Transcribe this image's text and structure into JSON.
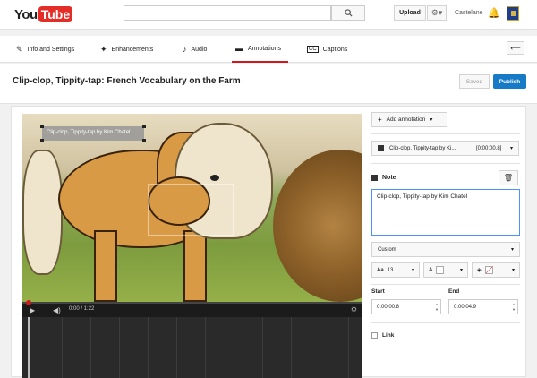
{
  "header": {
    "logo_you": "You",
    "logo_tube": "Tube",
    "search_placeholder": "",
    "upload_label": "Upload",
    "username": "Castelane"
  },
  "tabs": [
    {
      "label": "Info and Settings",
      "icon": "pencil-icon"
    },
    {
      "label": "Enhancements",
      "icon": "magic-wand-icon"
    },
    {
      "label": "Audio",
      "icon": "music-note-icon"
    },
    {
      "label": "Annotations",
      "icon": "speech-bubble-icon",
      "active": true
    },
    {
      "label": "Captions",
      "icon": "cc-icon"
    }
  ],
  "video": {
    "title": "Clip-clop, Tippity-tap: French Vocabulary on the Farm",
    "saved_label": "Saved",
    "publish_label": "Publish",
    "overlay_note": "Clip-clop, Tippity-tap by Kim Chatel",
    "time_display": "0:00 / 1:22"
  },
  "panel": {
    "add_annotation_label": "Add annotation",
    "annotation_item_label": "Clip-clop, Tippity-tap by Ki...",
    "annotation_item_time": "[0:00:00.8]",
    "type_label": "Note",
    "note_text": "Clip-clop, Tippity-tap by Kim Chatel",
    "style_value": "Custom",
    "font_size": "13",
    "font_label": "A",
    "start_label": "Start",
    "end_label": "End",
    "start_value": "0:00:00.8",
    "end_value": "0:00:04.9",
    "link_label": "Link"
  },
  "colors": {
    "brand_red": "#e52d27",
    "publish_blue": "#167ac6",
    "active_tab_underline": "#cc181e"
  }
}
